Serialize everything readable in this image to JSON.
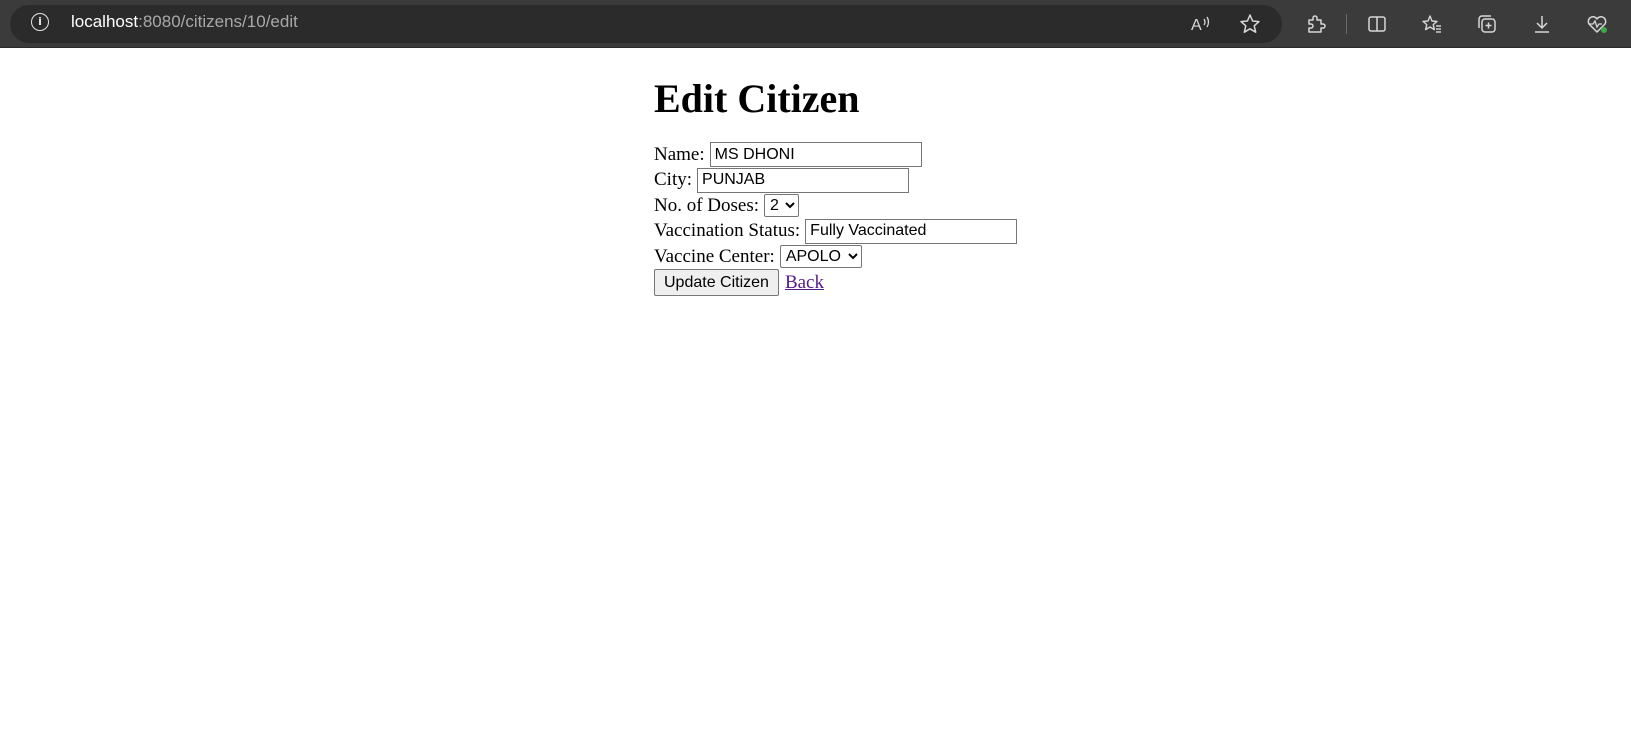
{
  "browser": {
    "url_host": "localhost",
    "url_path": ":8080/citizens/10/edit",
    "icons": [
      "info-icon",
      "read-aloud-icon",
      "favorite-star-icon",
      "extensions-icon",
      "split-screen-icon",
      "favorites-icon",
      "collections-icon",
      "downloads-icon",
      "browser-essentials-icon"
    ]
  },
  "page": {
    "title": "Edit Citizen"
  },
  "form": {
    "name_label": "Name:",
    "name_value": "MS DHONI",
    "city_label": "City:",
    "city_value": "PUNJAB",
    "doses_label": "No. of Doses:",
    "doses_selected": "2",
    "status_label": "Vaccination Status:",
    "status_value": "Fully Vaccinated",
    "center_label": "Vaccine Center:",
    "center_selected": "APOLO",
    "submit_label": "Update Citizen",
    "back_label": "Back"
  },
  "colors": {
    "link_visited": "#551a8b",
    "browser_bar": "#3b3b3b",
    "address_bar": "#2b2b2b"
  }
}
